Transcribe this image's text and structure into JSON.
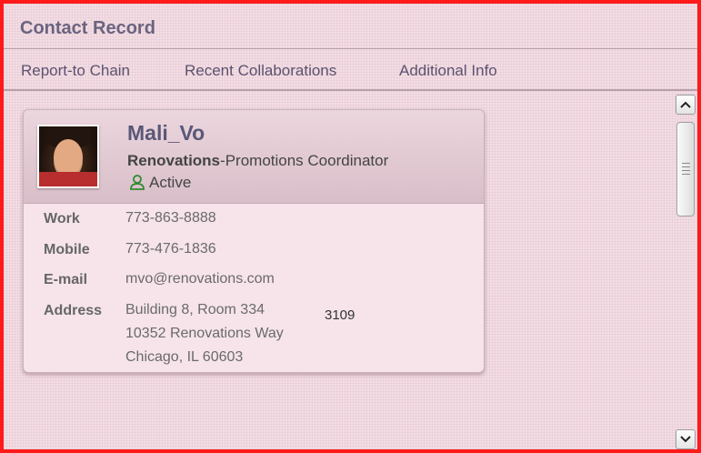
{
  "window": {
    "title": "Contact Record"
  },
  "tabs": [
    {
      "label": "Report-to Chain"
    },
    {
      "label": "Recent Collaborations"
    },
    {
      "label": "Additional Info"
    }
  ],
  "contact": {
    "name": "Mali_Vo",
    "organization": "Renovations",
    "separator": "-",
    "job_title": "Promotions Coordinator",
    "status": "Active",
    "fields": [
      {
        "label": "Work",
        "value": "773-863-8888"
      },
      {
        "label": "Mobile",
        "value": "773-476-1836"
      },
      {
        "label": "E-mail",
        "value": "mvo@renovations.com"
      },
      {
        "label": "Address",
        "lines": [
          "Building 8, Room 334",
          "10352 Renovations Way",
          "Chicago, IL  60603"
        ]
      }
    ],
    "overlapping_text": "3109"
  },
  "colors": {
    "window_border": "#ff1a1a",
    "background": "#f4dde4",
    "title_text": "#6a6480",
    "status_icon": "#2e8b2e"
  },
  "icons": {
    "status": "person-icon",
    "scroll_up": "chevron-up-icon",
    "scroll_down": "chevron-down-icon"
  }
}
